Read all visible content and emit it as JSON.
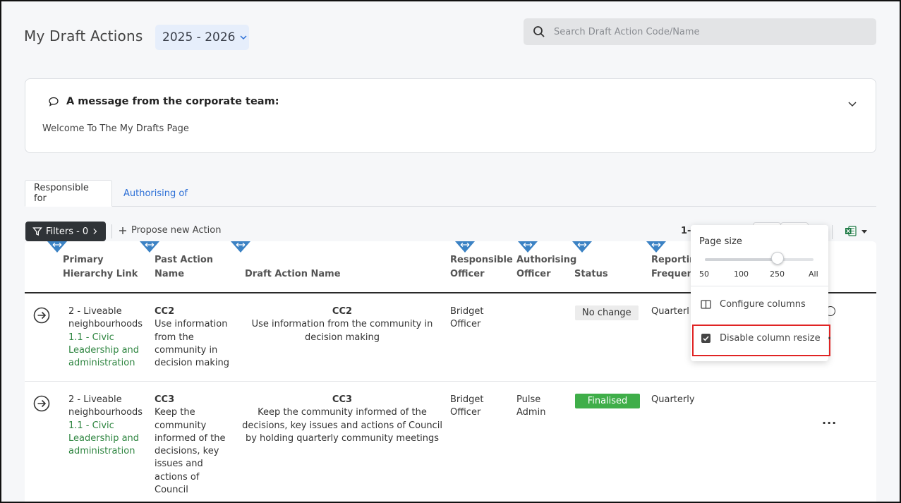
{
  "header": {
    "title": "My Draft Actions",
    "year": "2025 - 2026",
    "search_placeholder": "Search Draft Action Code/Name"
  },
  "message": {
    "title": "A message from the corporate team:",
    "body": "Welcome To The My Drafts Page"
  },
  "tabs": [
    {
      "label": "Responsible for",
      "active": true
    },
    {
      "label": "Authorising of",
      "active": false
    }
  ],
  "toolbar": {
    "filters_label": "Filters - 0",
    "propose_label": "Propose new Action",
    "pager_text": "1-"
  },
  "columns": {
    "primary": [
      "Primary",
      "Hierarchy Link"
    ],
    "past": [
      "Past Action",
      "Name"
    ],
    "draft": "Draft Action Name",
    "responsible": [
      "Responsible",
      "Officer"
    ],
    "authorising": [
      "Authorising",
      "Officer"
    ],
    "status": "Status",
    "reporting": [
      "Reportin",
      "Frequenc"
    ]
  },
  "rows": [
    {
      "hierarchy_main": [
        "2 - Liveable",
        "neighbourhoods"
      ],
      "hierarchy_sub": [
        "1.1 - Civic",
        "Leadership and",
        "administration"
      ],
      "past_code": "CC2",
      "past_name": [
        "Use information",
        "from the",
        "community in",
        "decision making"
      ],
      "draft_code": "CC2",
      "draft_name": [
        "Use information from the community in",
        "decision making"
      ],
      "responsible": [
        "Bridget",
        "Officer"
      ],
      "authorising": [
        "",
        ""
      ],
      "status": "No change",
      "reporting": "Quarterl"
    },
    {
      "hierarchy_main": [
        "2 - Liveable",
        "neighbourhoods"
      ],
      "hierarchy_sub": [
        "1.1 - Civic",
        "Leadership and",
        "administration"
      ],
      "past_code": "CC3",
      "past_name": [
        "Keep the",
        "community",
        "informed of the",
        "decisions, key",
        "issues and",
        "actions of",
        "Council"
      ],
      "draft_code": "CC3",
      "draft_name": [
        "Keep the community informed of the",
        "decisions, key issues and actions of Council",
        "by holding quarterly community meetings"
      ],
      "responsible": [
        "Bridget",
        "Officer"
      ],
      "authorising": [
        "Pulse",
        "Admin"
      ],
      "status": "Finalised",
      "reporting": "Quarterly"
    }
  ],
  "popover": {
    "page_size_label": "Page size",
    "page_size_options": [
      "50",
      "100",
      "250",
      "All"
    ],
    "selected_option": "250",
    "configure_label": "Configure columns",
    "disable_resize_label": "Disable column resize",
    "disable_resize_checked": true
  },
  "colors": {
    "accent_blue": "#2c6fd6",
    "finalised_green": "#3fae49",
    "hierarchy_green": "#2e8540",
    "resize_marker_blue": "#3b82c4",
    "highlight_red": "#e02424"
  }
}
